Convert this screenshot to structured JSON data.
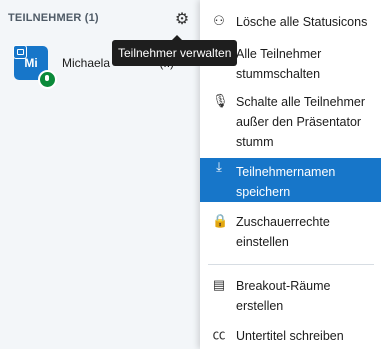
{
  "panel": {
    "header": "TEILNEHMER (1)",
    "participant": {
      "initials": "Mi",
      "name": "Michaela",
      "name_suffix": "(..)"
    }
  },
  "tooltip": "Teilnehmer verwalten",
  "menu": {
    "items": [
      {
        "icon": "clear-status-icon",
        "label": "Lösche alle Statusicons"
      },
      {
        "icon": "mute-all-icon",
        "label": "Alle Teilnehmer stummschalten"
      },
      {
        "icon": "mute-except-presenter-icon",
        "label": "Schalte alle Teilnehmer außer den Präsentator stumm"
      },
      {
        "icon": "save-names-icon",
        "label": "Teilnehmernamen speichern"
      },
      {
        "icon": "lock-icon",
        "label": "Zuschauerrechte einstellen"
      },
      {
        "icon": "breakout-icon",
        "label": "Breakout-Räume erstellen"
      },
      {
        "icon": "captions-icon",
        "label": "Untertitel schreiben"
      }
    ]
  },
  "colors": {
    "accent": "#1776c9",
    "panel_bg": "#f3f6f9",
    "mic_badge": "#0b8a3a",
    "tooltip_bg": "#1e1e1e"
  }
}
